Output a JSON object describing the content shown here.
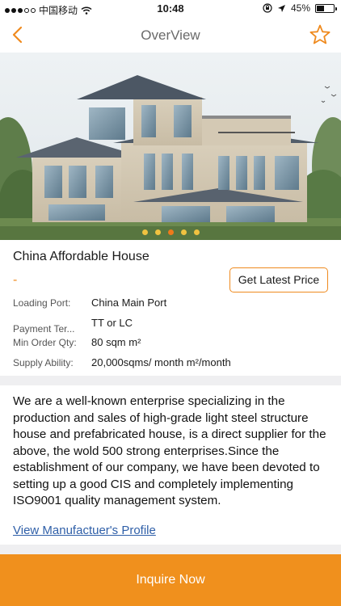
{
  "status_bar": {
    "carrier": "中国移动",
    "time": "10:48",
    "battery_text": "45%",
    "battery_level": 0.45
  },
  "nav": {
    "title": "OverView"
  },
  "gallery": {
    "page_count": 5,
    "active_index": 2
  },
  "product": {
    "title": "China Affordable House",
    "price": "-",
    "price_button_label": "Get Latest Price",
    "specs": [
      {
        "label": "Loading Port:",
        "value": "China Main Port"
      },
      {
        "label": "Payment Ter...",
        "value": "TT or LC"
      },
      {
        "label": "Min Order Qty:",
        "value": "80 sqm m²"
      },
      {
        "label": "Supply Ability:",
        "value": "20,000sqms/ month m²/month"
      }
    ]
  },
  "description": {
    "text": "We are  a well-known enterprise specializing in the production and sales of high-grade light steel structure house and prefabricated house, is a direct supplier for the above, the wold 500 strong enterprises.Since the establishment of our company, we have been devoted to setting up a good CIS and completely implementing ISO9001 quality management system.",
    "profile_link": "View Manufactuer's Profile"
  },
  "footer": {
    "inquire_label": "Inquire Now"
  },
  "colors": {
    "accent": "#ef8a1e",
    "footer": "#f0901d",
    "link": "#2f5fa8"
  }
}
